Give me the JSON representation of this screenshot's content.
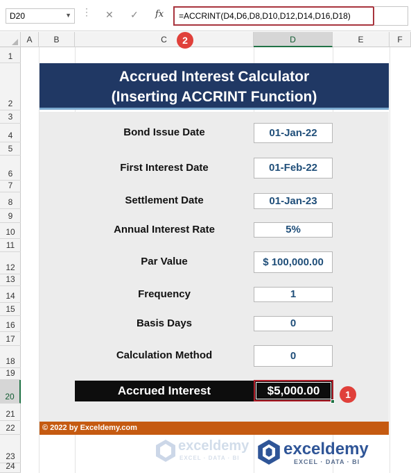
{
  "formula_bar": {
    "name_box": "D20",
    "formula": "=ACCRINT(D4,D6,D8,D10,D12,D14,D16,D18)",
    "cancel_icon": "close-icon",
    "enter_icon": "checkmark-icon",
    "fx_label": "fx"
  },
  "badges": {
    "formula": "2",
    "cell": "1"
  },
  "columns": [
    "A",
    "B",
    "C",
    "D",
    "E",
    "F"
  ],
  "selected_column": "D",
  "rows": [
    "1",
    "2",
    "3",
    "4",
    "5",
    "6",
    "7",
    "8",
    "9",
    "10",
    "11",
    "12",
    "13",
    "14",
    "15",
    "16",
    "17",
    "18",
    "19",
    "20",
    "21",
    "22",
    "23",
    "24"
  ],
  "selected_row": "20",
  "calculator": {
    "title_line1": "Accrued Interest Calculator",
    "title_line2": "(Inserting ACCRINT Function)",
    "fields": [
      {
        "label": "Bond Issue Date",
        "value": "01-Jan-22"
      },
      {
        "label": "First Interest Date",
        "value": "01-Feb-22"
      },
      {
        "label": "Settlement Date",
        "value": "01-Jan-23"
      },
      {
        "label": "Annual Interest Rate",
        "value": "5%"
      },
      {
        "label": "Par Value",
        "value": "$ 100,000.00"
      },
      {
        "label": "Frequency",
        "value": "1"
      },
      {
        "label": "Basis Days",
        "value": "0"
      },
      {
        "label": "Calculation Method",
        "value": "0"
      }
    ],
    "result": {
      "label": "Accrued Interest",
      "value": "$5,000.00"
    },
    "footer": "© 2022 by Exceldemy.com"
  },
  "watermark": {
    "name": "exceldemy",
    "tagline": "EXCEL · DATA · BI"
  },
  "colors": {
    "title_bg": "#203864",
    "footer_bg": "#c55a11",
    "highlight": "#b11f2a",
    "badge": "#e0403a"
  }
}
